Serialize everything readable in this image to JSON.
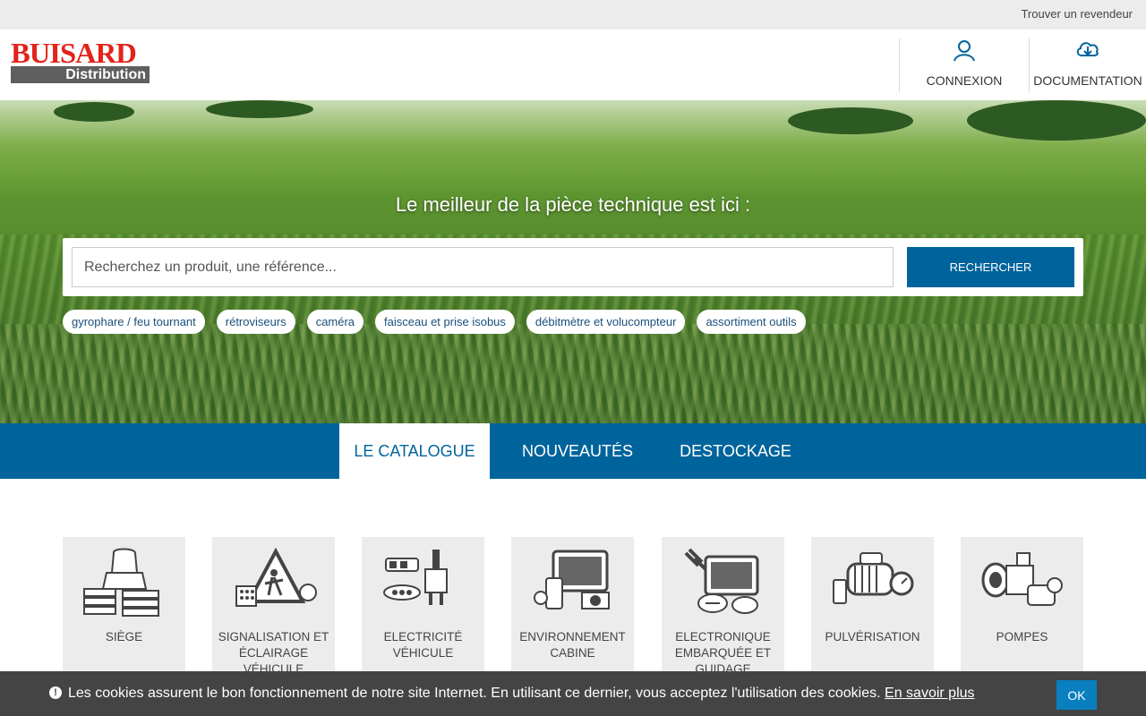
{
  "topbar": {
    "dealer_link": "Trouver un revendeur"
  },
  "header": {
    "logo_brand": "BUISARD",
    "logo_sub": "Distribution",
    "connexion_label": "CONNEXION",
    "documentation_label": "DOCUMENTATION",
    "icons": {
      "connexion": "user-icon",
      "documentation": "cloud-download-icon"
    }
  },
  "hero": {
    "title": "Le meilleur de la pièce technique est ici :",
    "search_placeholder": "Recherchez un produit, une référence...",
    "search_button": "RECHERCHER",
    "tags": [
      "gyrophare / feu tournant",
      "rétroviseurs",
      "caméra",
      "faisceau et prise isobus",
      "débitmètre et volucompteur",
      "assortiment outils"
    ]
  },
  "tabs": [
    {
      "label": "LE CATALOGUE",
      "active": true
    },
    {
      "label": "NOUVEAUTÉS",
      "active": false
    },
    {
      "label": "DESTOCKAGE",
      "active": false
    }
  ],
  "categories": [
    {
      "label": "SIÈGE"
    },
    {
      "label": "SIGNALISATION ET ÉCLAIRAGE VÉHICULE"
    },
    {
      "label": "ELECTRICITÉ VÉHICULE"
    },
    {
      "label": "ENVIRONNEMENT CABINE"
    },
    {
      "label": "ELECTRONIQUE EMBARQUÉE ET GUIDAGE"
    },
    {
      "label": "PULVÉRISATION"
    },
    {
      "label": "POMPES"
    }
  ],
  "cookie": {
    "message": "Les cookies assurent le bon fonctionnement de notre site Internet. En utilisant ce dernier, vous acceptez l'utilisation des cookies.",
    "more_link": "En savoir plus",
    "ok_button": "OK"
  },
  "colors": {
    "primary": "#00649c",
    "logo_red": "#e2231a",
    "tile_bg": "#ececec",
    "cookie_bg": "#444444"
  }
}
